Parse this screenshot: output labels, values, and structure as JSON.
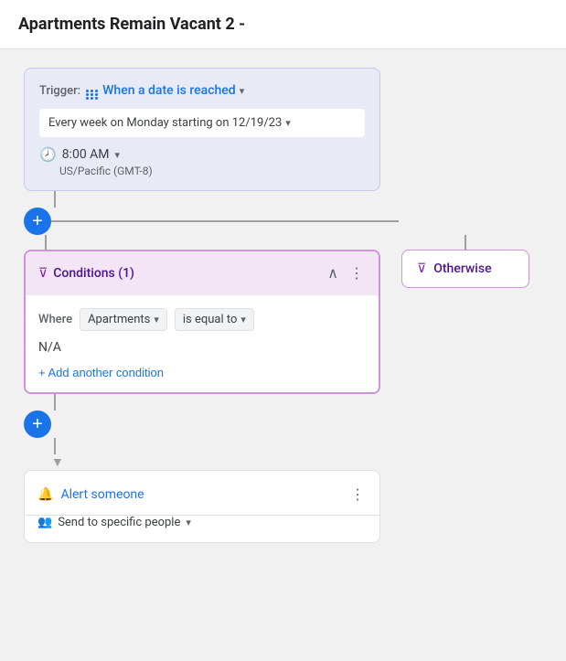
{
  "header": {
    "title": "Apartments Remain Vacant 2 -"
  },
  "trigger": {
    "label": "Trigger:",
    "type": "When a date is reached",
    "schedule": "Every week on Monday starting on 12/19/23",
    "time": "8:00 AM",
    "timezone": "US/Pacific (GMT-8)"
  },
  "plus_buttons": {
    "label": "+"
  },
  "conditions": {
    "title": "Conditions (1)",
    "where_label": "Where",
    "field": "Apartments",
    "operator": "is equal to",
    "value": "N/A",
    "add_condition": "+ Add another condition"
  },
  "otherwise": {
    "label": "Otherwise"
  },
  "alert": {
    "title": "Alert someone",
    "recipient_label": "Send to specific people",
    "recipient_dropdown": "▾"
  },
  "icons": {
    "filter": "⊽",
    "dots": "⋮",
    "chevron_up": "^",
    "clock": "⏰",
    "bell": "🔔",
    "person": "👥",
    "plus": "+"
  }
}
